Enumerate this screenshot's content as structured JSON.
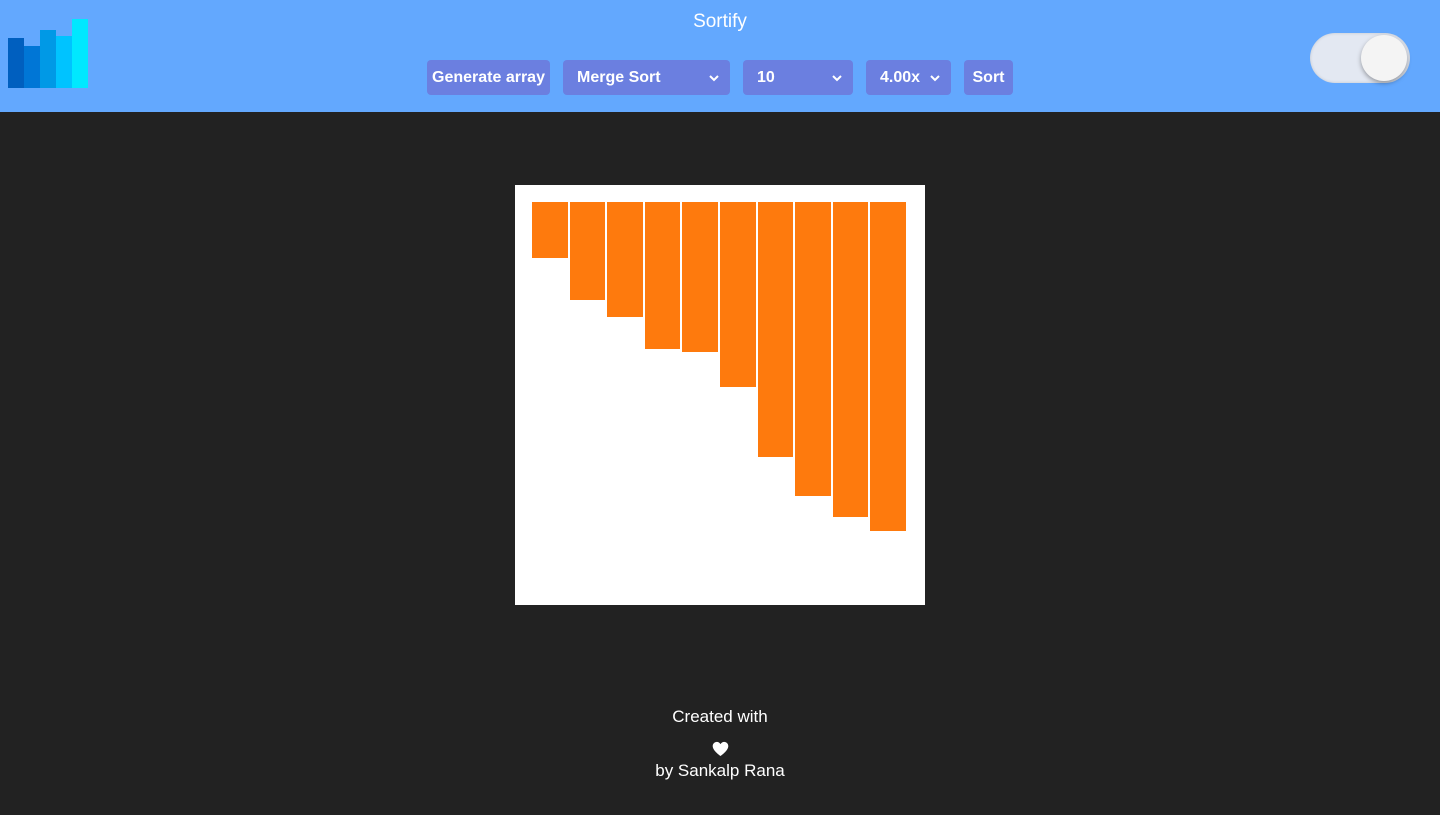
{
  "header": {
    "title": "Sortify",
    "background_color": "#63a8fe",
    "logo_icon": "bar-chart-logo-icon",
    "logo_colors": [
      "#005fbf",
      "#0076d6",
      "#0099e6",
      "#00c3ff",
      "#00e8ff"
    ]
  },
  "controls": {
    "generate_label": "Generate array",
    "algorithm": {
      "selected": "Merge Sort"
    },
    "size": {
      "selected": "10"
    },
    "speed": {
      "selected": "4.00x"
    },
    "sort_label": "Sort",
    "button_color": "#6b7fe0"
  },
  "theme_toggle": {
    "state": "on"
  },
  "chart_data": {
    "type": "bar",
    "values": [
      0.145,
      0.254,
      0.298,
      0.381,
      0.389,
      0.479,
      0.661,
      0.762,
      0.816,
      0.852
    ],
    "bar_color": "#fe7a0d",
    "orientation": "hanging-from-top"
  },
  "footer": {
    "line1": "Created with",
    "heart_icon": "heart-icon",
    "line2": "by Sankalp Rana"
  }
}
